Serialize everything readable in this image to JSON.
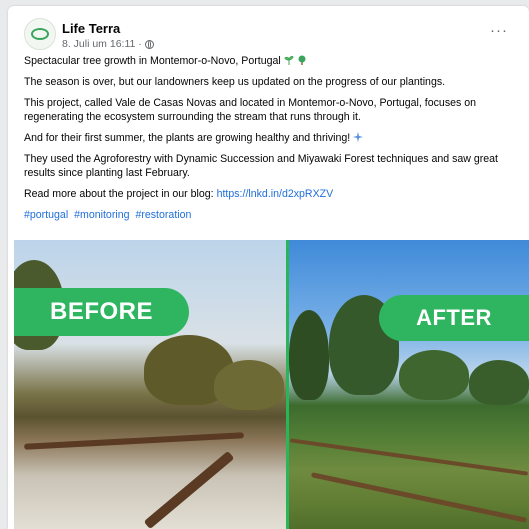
{
  "post": {
    "page_name": "Life Terra",
    "timestamp": "8. Juli um 16:11 ·",
    "avatar_text": "LIFE TERRA",
    "more_label": "···",
    "paragraphs": [
      "Spectacular tree growth in Montemor-o-Novo, Portugal",
      "The season is over, but our landowners keep us updated on the progress of our plantings.",
      "This project, called Vale de Casas Novas and located in Montemor-o-Novo, Portugal, focuses on regenerating the ecosystem surrounding the stream that runs through it.",
      "And for their first summer, the plants are growing healthy and thriving!",
      "They used the Agroforestry with Dynamic Succession and Miyawaki Forest techniques and saw great results since planting last February."
    ],
    "readmore_prefix": "Read more about the project in our blog:",
    "readmore_link": "https://lnkd.in/d2xpRXZV",
    "hashtags": [
      "#portugal",
      "#monitoring",
      "#restoration"
    ]
  },
  "images": {
    "before_label": "BEFORE",
    "after_label": "AFTER",
    "accent_color": "#2fb55f"
  }
}
